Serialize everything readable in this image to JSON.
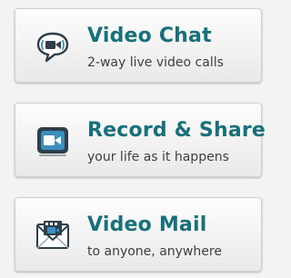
{
  "items": [
    {
      "title": "Video Chat",
      "subtitle": "2-way live video calls",
      "icon": "video-chat-bubble-icon"
    },
    {
      "title": "Record & Share",
      "subtitle": "your life as it happens",
      "icon": "video-record-icon"
    },
    {
      "title": "Video Mail",
      "subtitle": "to anyone, anywhere",
      "icon": "video-mail-envelope-icon"
    }
  ],
  "colors": {
    "title": "#17707b",
    "subtitle": "#3f3f3f",
    "icon_dark": "#2f3f4a",
    "icon_accent": "#3a8ec0"
  }
}
